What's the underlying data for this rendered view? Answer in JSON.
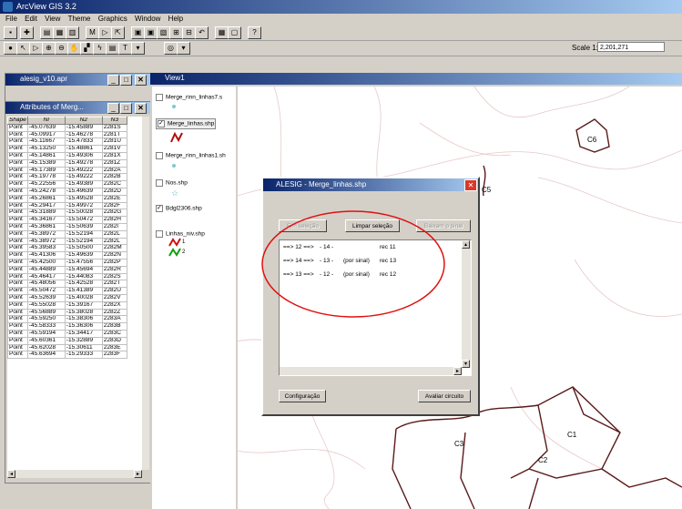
{
  "app": {
    "title": "ArcView GIS 3.2"
  },
  "menu": [
    "File",
    "Edit",
    "View",
    "Theme",
    "Graphics",
    "Window",
    "Help"
  ],
  "scale": {
    "label": "Scale 1:",
    "value": "2,201,271"
  },
  "project": {
    "title": "alesig_v10.apr"
  },
  "attributes": {
    "title": "Attributes of Merg...",
    "columns": [
      "Shape",
      "NI",
      "N2",
      "N3"
    ],
    "rows": [
      [
        "Point",
        "-45.07639",
        "-15.45889",
        "2281S"
      ],
      [
        "Point",
        "-45.09917",
        "-15.46278",
        "2281T"
      ],
      [
        "Point",
        "-45.11667",
        "-15.47833",
        "2281U"
      ],
      [
        "Point",
        "-45.13250",
        "-15.48861",
        "2281V"
      ],
      [
        "Point",
        "-45.14861",
        "-15.49306",
        "2281X"
      ],
      [
        "Point",
        "-45.15389",
        "-15.49278",
        "2281Z"
      ],
      [
        "Point",
        "-45.17389",
        "-15.49222",
        "2282A"
      ],
      [
        "Point",
        "-45.19778",
        "-15.49222",
        "2282B"
      ],
      [
        "Point",
        "-45.22556",
        "-15.49389",
        "2282C"
      ],
      [
        "Point",
        "-45.24278",
        "-15.49639",
        "2282D"
      ],
      [
        "Point",
        "-45.26861",
        "-15.49528",
        "2282E"
      ],
      [
        "Point",
        "-45.29417",
        "-15.49972",
        "2282F"
      ],
      [
        "Point",
        "-45.31889",
        "-15.50028",
        "2282G"
      ],
      [
        "Point",
        "-45.34167",
        "-15.50472",
        "2282H"
      ],
      [
        "Point",
        "-45.36861",
        "-15.50639",
        "2282I"
      ],
      [
        "Point",
        "-45.38972",
        "-15.52194",
        "2282L"
      ],
      [
        "Point",
        "-45.38972",
        "-15.52194",
        "2282L"
      ],
      [
        "Point",
        "-45.39583",
        "-15.50500",
        "2282M"
      ],
      [
        "Point",
        "-45.41306",
        "-15.49639",
        "2282N"
      ],
      [
        "Point",
        "-45.42500",
        "-15.47556",
        "2282P"
      ],
      [
        "Point",
        "-45.44889",
        "-15.45694",
        "2282R"
      ],
      [
        "Point",
        "-45.46417",
        "-15.44083",
        "2282S"
      ],
      [
        "Point",
        "-45.48056",
        "-15.42528",
        "2282T"
      ],
      [
        "Point",
        "-45.50472",
        "-15.41389",
        "2282U"
      ],
      [
        "Point",
        "-45.52639",
        "-15.40028",
        "2282V"
      ],
      [
        "Point",
        "-45.55028",
        "-15.39167",
        "2282X"
      ],
      [
        "Point",
        "-45.56889",
        "-15.38028",
        "2282Z"
      ],
      [
        "Point",
        "-45.59250",
        "-15.38306",
        "2283A"
      ],
      [
        "Point",
        "-45.58333",
        "-15.36306",
        "2283B"
      ],
      [
        "Point",
        "-45.59194",
        "-15.34417",
        "2283C"
      ],
      [
        "Point",
        "-45.60361",
        "-15.32889",
        "2283D"
      ],
      [
        "Point",
        "-45.62028",
        "-15.30611",
        "2283E"
      ],
      [
        "Point",
        "-45.63694",
        "-15.29333",
        "2283F"
      ]
    ]
  },
  "view": {
    "title": "View1",
    "themes": [
      {
        "name": "Merge_rinn_linhas7.s",
        "checked": false
      },
      {
        "name": "Merge_linhas.shp",
        "checked": true
      },
      {
        "name": "Merge_rinn_linhas1.sh",
        "checked": false
      },
      {
        "name": "Nos.shp",
        "checked": false
      },
      {
        "name": "Bdgl2306.shp",
        "checked": true
      },
      {
        "name": "Linhas_niv.shp",
        "checked": false
      }
    ],
    "legend_values": [
      "1",
      "2"
    ],
    "labels": [
      "C6",
      "C5",
      "C3",
      "C1",
      "C2"
    ]
  },
  "dialog": {
    "title": "ALESIG - Merge_linhas.shp",
    "btn_fim": "Fim seleção",
    "btn_limpar": "Limpar seleção",
    "btn_baixar": "Baixam o sinal",
    "btn_config": "Configuração",
    "btn_avaliar": "Avaliar circuito",
    "list": [
      {
        "from": "==> 12 ==>",
        "mid": "- 14 -",
        "note": "",
        "rec": "rec 11"
      },
      {
        "from": "==> 14 ==>",
        "mid": "- 13 -",
        "note": "(por sinal)",
        "rec": "rec 13"
      },
      {
        "from": "==> 13 ==>",
        "mid": "- 12 -",
        "note": "(por sinal)",
        "rec": "rec 12"
      }
    ]
  },
  "colors": {
    "accent": "#0a246a",
    "highlight": "#e01010",
    "line": "#5a1a1a"
  }
}
